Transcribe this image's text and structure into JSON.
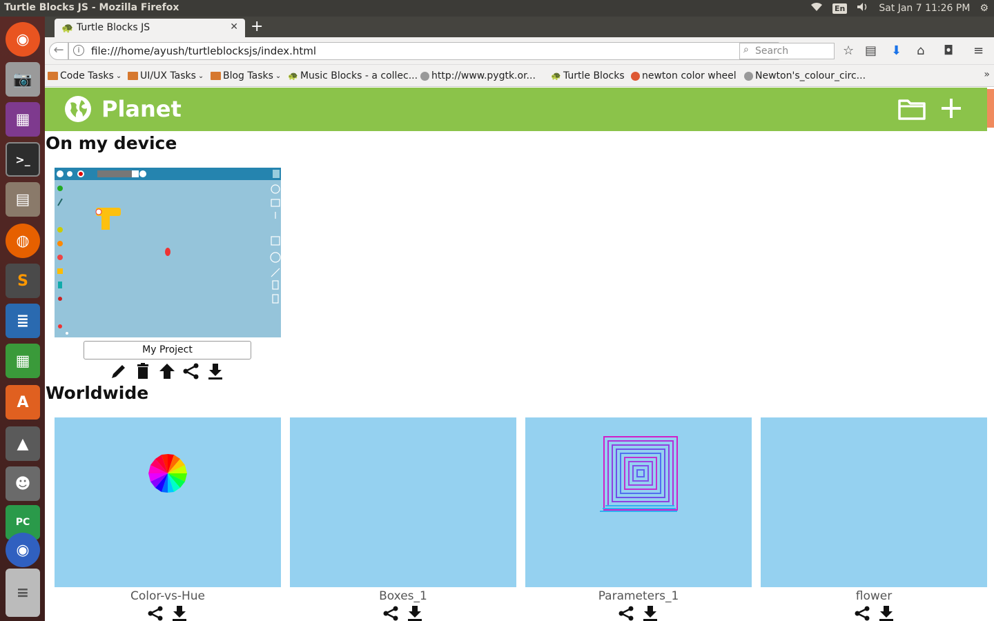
{
  "system_panel": {
    "window_title": "Turtle Blocks JS - Mozilla Firefox",
    "keyboard_layout": "En",
    "clock": "Sat Jan  7 11:26 PM"
  },
  "browser": {
    "tab_title": "Turtle Blocks JS",
    "url": "file:///home/ayush/turtleblocksjs/index.html",
    "search_placeholder": "Search",
    "bookmarks": [
      {
        "label": "Code Tasks",
        "icon": "folder-icon",
        "dropdown": true
      },
      {
        "label": "UI/UX Tasks",
        "icon": "folder-icon",
        "dropdown": true
      },
      {
        "label": "Blog Tasks",
        "icon": "folder-icon",
        "dropdown": true
      },
      {
        "label": "Music Blocks - a collec...",
        "icon": "turtle-icon",
        "dropdown": false
      },
      {
        "label": "http://www.pygtk.or...",
        "icon": "globe-icon",
        "dropdown": false
      },
      {
        "label": "Turtle Blocks",
        "icon": "turtle-icon",
        "dropdown": false
      },
      {
        "label": "newton color wheel",
        "icon": "duckduckgo-icon",
        "dropdown": false
      },
      {
        "label": "Newton's_colour_circ...",
        "icon": "globe-icon",
        "dropdown": false
      }
    ]
  },
  "planet": {
    "title": "Planet",
    "header_color": "#8bc34a",
    "local_section_title": "On my device",
    "worldwide_section_title": "Worldwide",
    "local_projects": [
      {
        "name": "My Project",
        "actions": [
          "edit-icon",
          "delete-icon",
          "publish-icon",
          "share-icon",
          "download-icon"
        ]
      }
    ],
    "worldwide_projects": [
      {
        "name": "Color-vs-Hue",
        "thumbnail": "color-wheel"
      },
      {
        "name": "Boxes_1",
        "thumbnail": "blank"
      },
      {
        "name": "Parameters_1",
        "thumbnail": "square-spiral"
      },
      {
        "name": "flower",
        "thumbnail": "blank"
      }
    ]
  },
  "launcher_icons": [
    "ubuntu-dash-icon",
    "camera-icon",
    "workspace-icon",
    "terminal-icon",
    "files-icon",
    "firefox-icon",
    "sublime-text-icon",
    "writer-icon",
    "calc-icon",
    "software-center-icon",
    "inkscape-icon",
    "gimp-icon",
    "pycharm-icon",
    "app-icon",
    "trash-icon"
  ]
}
